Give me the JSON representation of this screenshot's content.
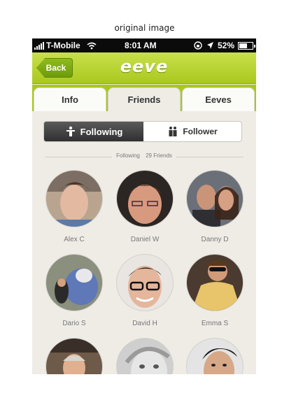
{
  "caption": "original image",
  "status_bar": {
    "carrier": "T-Mobile",
    "time": "8:01 AM",
    "battery": "52%"
  },
  "nav": {
    "back_label": "Back",
    "logo": "eeve"
  },
  "tabs": [
    {
      "label": "Info"
    },
    {
      "label": "Friends"
    },
    {
      "label": "Eeves"
    }
  ],
  "segment": {
    "following_label": "Following",
    "follower_label": "Follower"
  },
  "divider": {
    "prefix": "Following",
    "count_label": "29 Friends"
  },
  "friends": [
    {
      "first": "Alex",
      "initial": "C"
    },
    {
      "first": "Daniel",
      "initial": "W"
    },
    {
      "first": "Danny",
      "initial": "D"
    },
    {
      "first": "Dario",
      "initial": "S"
    },
    {
      "first": "David",
      "initial": "H"
    },
    {
      "first": "Emma",
      "initial": "S"
    },
    {
      "first": "",
      "initial": ""
    },
    {
      "first": "",
      "initial": ""
    },
    {
      "first": "",
      "initial": ""
    }
  ],
  "colors": {
    "accent": "#a9c81f",
    "accent_dark": "#6f9b0c",
    "background": "#efece6"
  },
  "icons": [
    "wifi-icon",
    "rotation-lock-icon",
    "location-icon",
    "battery-icon",
    "person-icon",
    "people-icon"
  ]
}
